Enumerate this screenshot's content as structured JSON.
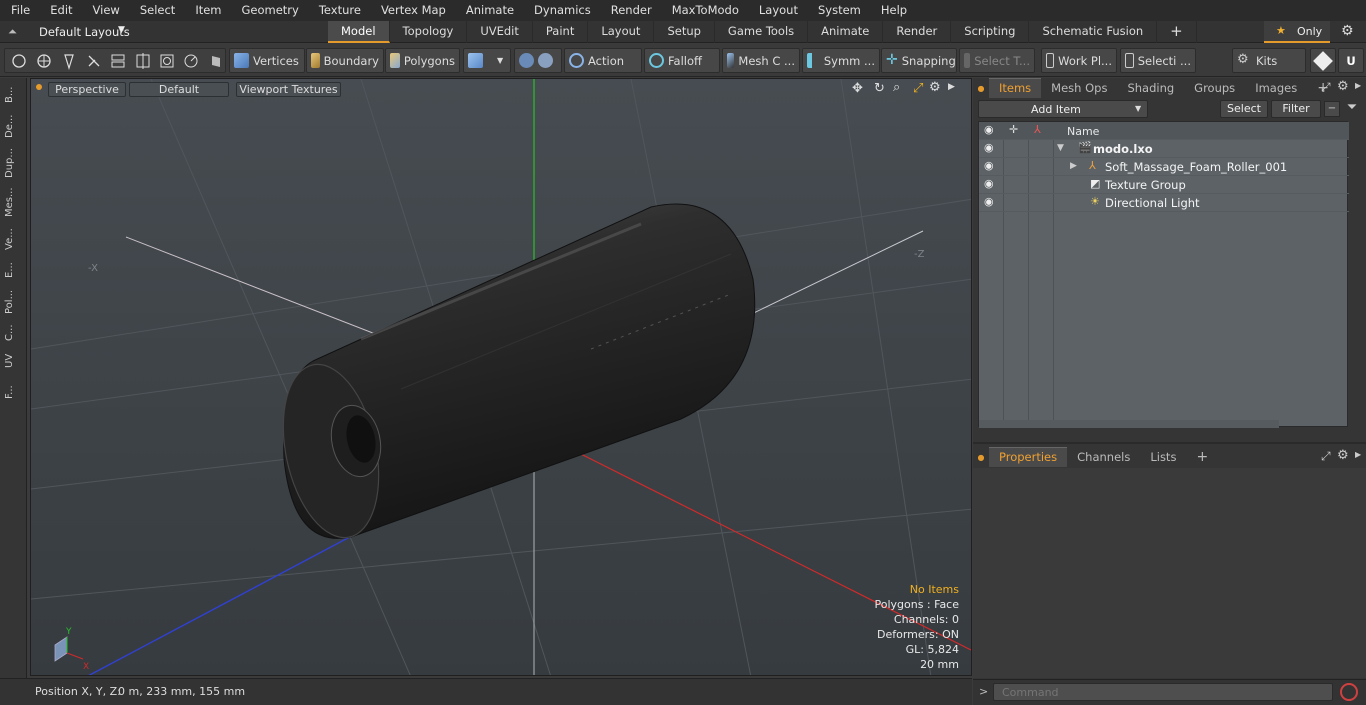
{
  "menu": [
    "File",
    "Edit",
    "View",
    "Select",
    "Item",
    "Geometry",
    "Texture",
    "Vertex Map",
    "Animate",
    "Dynamics",
    "Render",
    "MaxToModo",
    "Layout",
    "System",
    "Help"
  ],
  "layout_selector": "Default Layouts",
  "mode_tabs": [
    "Model",
    "Topology",
    "UVEdit",
    "Paint",
    "Layout",
    "Setup",
    "Game Tools",
    "Animate",
    "Render",
    "Scripting",
    "Schematic Fusion"
  ],
  "active_mode_tab": "Model",
  "only_label": "Only",
  "toolbar": {
    "vertices": "Vertices",
    "boundary": "Boundary",
    "polygons": "Polygons",
    "action": "Action",
    "falloff": "Falloff",
    "mesh": "Mesh C ...",
    "symmetry": "Symm ...",
    "snapping": "Snapping",
    "select_t": "Select T...",
    "work_plane": "Work Pl...",
    "selection": "Selecti ...",
    "kits": "Kits"
  },
  "left_strip": [
    "B...",
    "De...",
    "Dup...",
    "Mes...",
    "Ve...",
    "E...",
    "Pol...",
    "C...",
    "UV",
    "F..."
  ],
  "viewport": {
    "view": "Perspective",
    "shading": "Default",
    "textures": "Viewport Textures",
    "axis_neg_x": "-X",
    "axis_neg_z": "-Z",
    "gizmo_y": "Y",
    "gizmo_x": "X",
    "stats": {
      "items": "No Items",
      "polygons": "Polygons : Face",
      "channels": "Channels: 0",
      "deformers": "Deformers: ON",
      "gl": "GL: 5,824",
      "unit": "20 mm"
    }
  },
  "status": {
    "position_label": "Position X, Y, Z:",
    "position_value": "0 m, 233 mm, 155 mm"
  },
  "panel_tabs": [
    "Items",
    "Mesh Ops",
    "Shading",
    "Groups",
    "Images"
  ],
  "active_panel_tab": "Items",
  "add_item": "Add Item",
  "select_btn": "Select",
  "filter_btn": "Filter",
  "list_header": "Name",
  "items": [
    {
      "name": "modo.lxo"
    },
    {
      "name": "Soft_Massage_Foam_Roller_001"
    },
    {
      "name": "Texture Group"
    },
    {
      "name": "Directional Light"
    }
  ],
  "bottom_tabs": [
    "Properties",
    "Channels",
    "Lists"
  ],
  "active_bottom_tab": "Properties",
  "command_placeholder": "Command",
  "colors": {
    "accent": "#e59a2c",
    "x_axis": "#d02a2a",
    "y_axis": "#28c028",
    "z_axis": "#3040d0"
  }
}
